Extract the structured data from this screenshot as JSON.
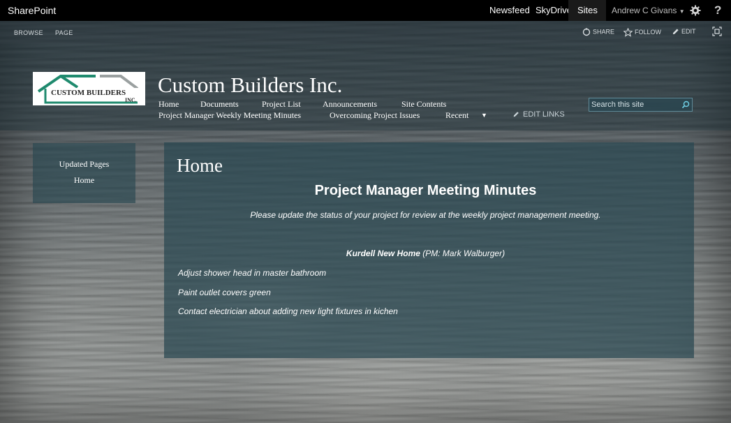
{
  "suite_bar": {
    "brand": "SharePoint",
    "links": [
      "Newsfeed",
      "SkyDrive",
      "Sites"
    ],
    "user": "Andrew C Givans",
    "help": "?"
  },
  "ribbon": {
    "tabs": [
      "BROWSE",
      "PAGE"
    ],
    "actions": [
      "SHARE",
      "FOLLOW",
      "EDIT"
    ]
  },
  "site": {
    "logo_text_1": "CUSTOM BUILDERS",
    "logo_text_2": "INC.",
    "title": "Custom Builders Inc.",
    "nav_row1": [
      "Home",
      "Documents",
      "Project List",
      "Announcements",
      "Site Contents"
    ],
    "nav_row2": [
      "Project Manager Weekly Meeting Minutes",
      "Overcoming Project Issues",
      "Recent"
    ],
    "edit_links": "EDIT LINKS",
    "search_placeholder": "Search this site"
  },
  "quick_launch": {
    "items": [
      "Updated Pages",
      "Home"
    ]
  },
  "content": {
    "page_title": "Home",
    "heading": "Project Manager Meeting Minutes",
    "intro": "Please update the status of your project for review at the weekly project management meeting.",
    "project_name": "Kurdell New Home",
    "project_pm": " (PM: Mark Walburger)",
    "tasks": [
      "Adjust shower head in master bathroom",
      "Paint outlet covers green",
      "Contact electrician about adding new light fixtures in kichen"
    ]
  },
  "colors": {
    "suite_bar": "#000000",
    "panel": "#28464f",
    "text": "#ffffff"
  }
}
